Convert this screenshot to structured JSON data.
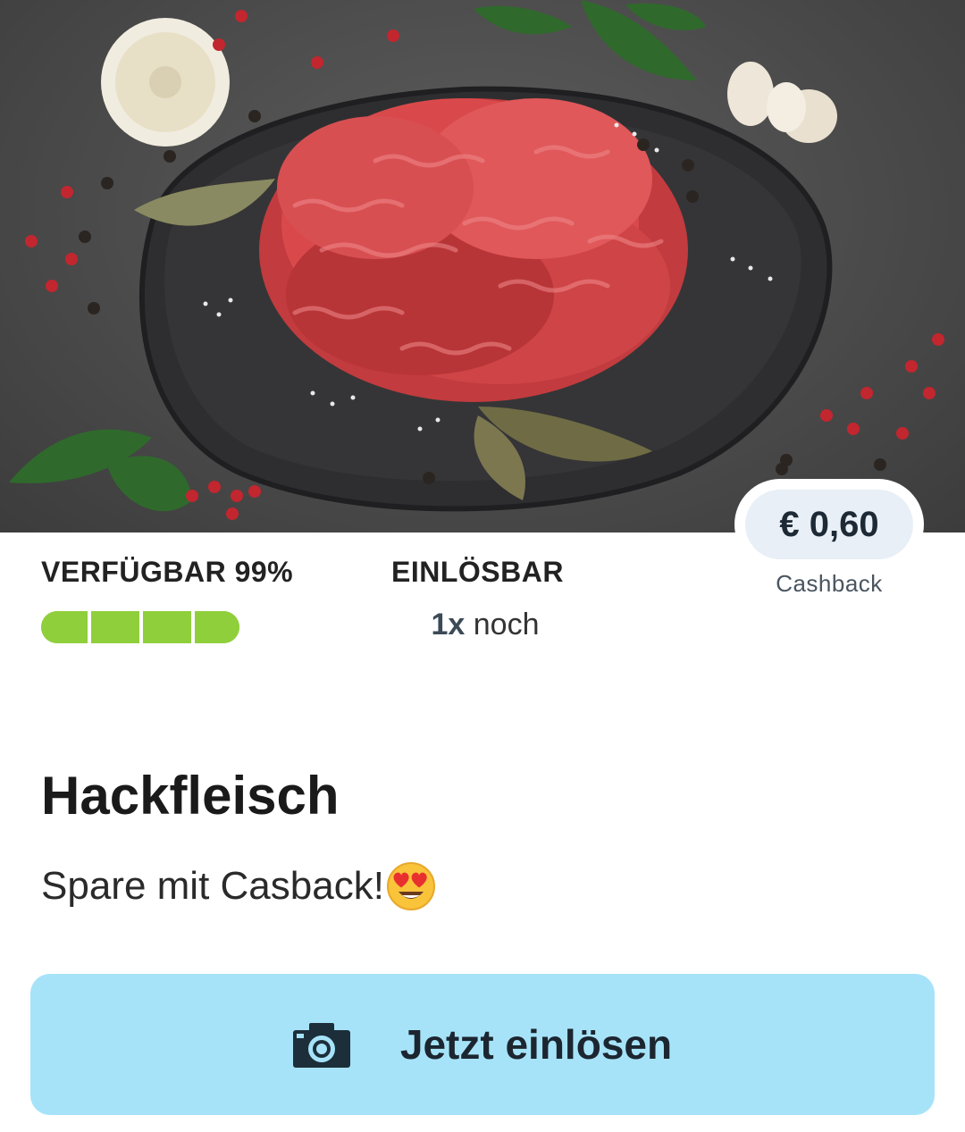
{
  "offer": {
    "title": "Hackfleisch",
    "subtitle": "Spare mit Casback!",
    "emoji_icon": "heart-eyes-emoji-icon"
  },
  "cashback": {
    "amount": "€ 0,60",
    "label": "Cashback"
  },
  "availability": {
    "label": "VERFÜGBAR 99%",
    "percent": 99,
    "bar_color": "#8fcf3c"
  },
  "redeemable": {
    "label": "EINLÖSBAR",
    "count": "1x",
    "suffix": "noch"
  },
  "cta": {
    "label": "Jetzt einlösen",
    "icon": "camera-icon",
    "background": "#a6e3f8"
  }
}
